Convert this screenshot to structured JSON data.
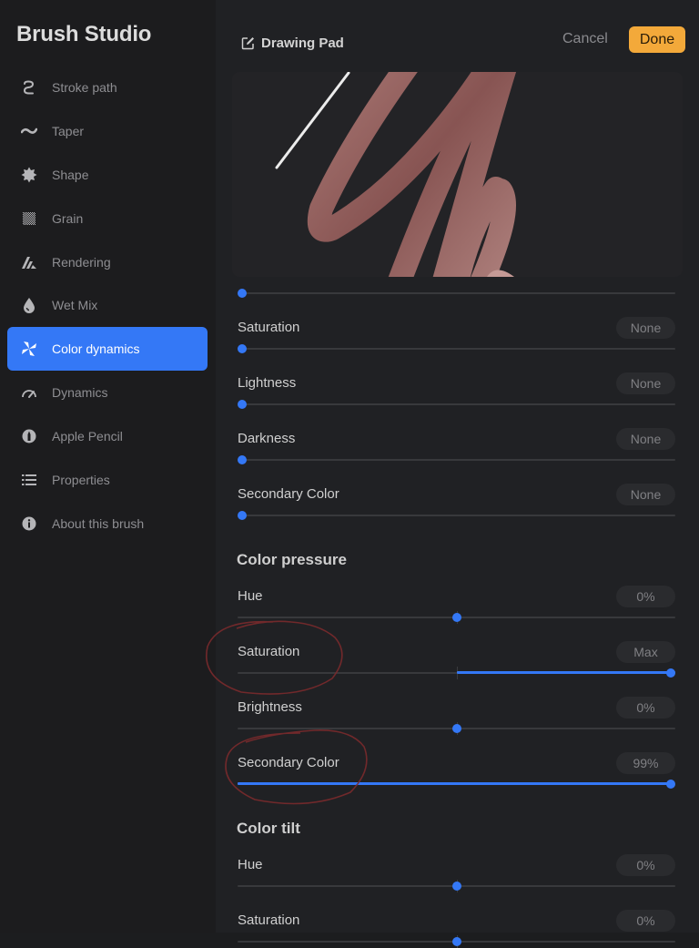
{
  "sidebar": {
    "title": "Brush Studio",
    "items": [
      {
        "label": "Stroke path",
        "icon": "stroke-path-icon",
        "active": false
      },
      {
        "label": "Taper",
        "icon": "taper-icon",
        "active": false
      },
      {
        "label": "Shape",
        "icon": "shape-icon",
        "active": false
      },
      {
        "label": "Grain",
        "icon": "grain-icon",
        "active": false
      },
      {
        "label": "Rendering",
        "icon": "rendering-icon",
        "active": false
      },
      {
        "label": "Wet Mix",
        "icon": "wet-mix-icon",
        "active": false
      },
      {
        "label": "Color dynamics",
        "icon": "color-dynamics-icon",
        "active": true
      },
      {
        "label": "Dynamics",
        "icon": "dynamics-icon",
        "active": false
      },
      {
        "label": "Apple Pencil",
        "icon": "apple-pencil-icon",
        "active": false
      },
      {
        "label": "Properties",
        "icon": "properties-icon",
        "active": false
      },
      {
        "label": "About this brush",
        "icon": "info-icon",
        "active": false
      }
    ]
  },
  "header": {
    "drawing_pad_label": "Drawing Pad",
    "cancel_label": "Cancel",
    "done_label": "Done"
  },
  "colors": {
    "accent": "#3478f6",
    "done_button": "#f3a93a",
    "stroke_color": "#9c6463",
    "annotation_circle": "#7a2a2c"
  },
  "stamp_jitter": {
    "top_slider": {
      "value_fraction": 0.0
    },
    "rows": [
      {
        "label": "Saturation",
        "value": "None",
        "fraction": 0.0
      },
      {
        "label": "Lightness",
        "value": "None",
        "fraction": 0.0
      },
      {
        "label": "Darkness",
        "value": "None",
        "fraction": 0.0
      },
      {
        "label": "Secondary Color",
        "value": "None",
        "fraction": 0.0
      }
    ]
  },
  "color_pressure": {
    "title": "Color pressure",
    "rows": [
      {
        "label": "Hue",
        "value": "0%",
        "fraction": 0.5,
        "bipolar": true
      },
      {
        "label": "Saturation",
        "value": "Max",
        "fraction": 1.0,
        "bipolar": true,
        "circled": true
      },
      {
        "label": "Brightness",
        "value": "0%",
        "fraction": 0.5,
        "bipolar": true
      },
      {
        "label": "Secondary Color",
        "value": "99%",
        "fraction": 0.99,
        "bipolar": false,
        "circled": true
      }
    ]
  },
  "color_tilt": {
    "title": "Color tilt",
    "rows": [
      {
        "label": "Hue",
        "value": "0%",
        "fraction": 0.5,
        "bipolar": true
      },
      {
        "label": "Saturation",
        "value": "0%",
        "fraction": 0.5,
        "bipolar": true
      }
    ]
  }
}
